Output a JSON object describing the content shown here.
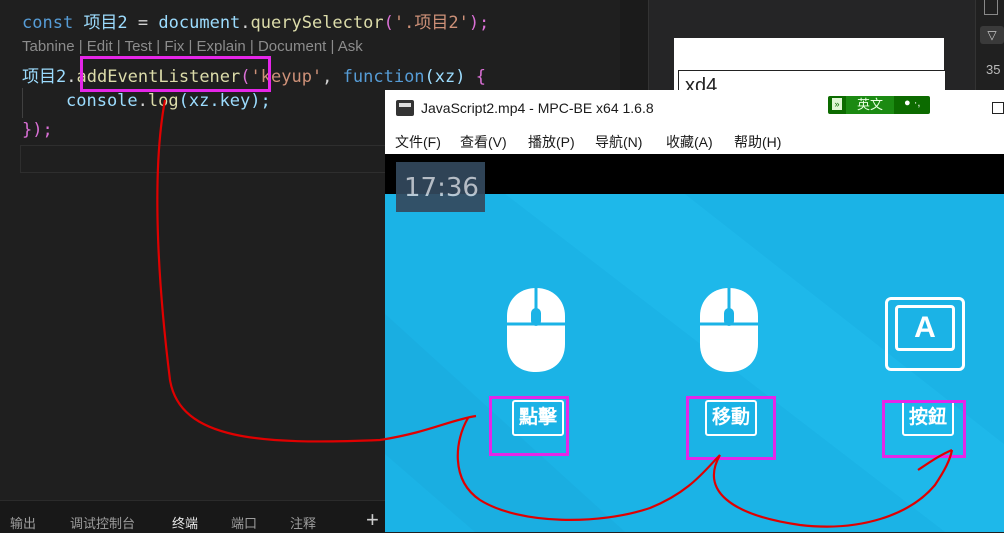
{
  "editor": {
    "line1": {
      "kw": "const",
      "var": "项目2",
      "op": " = ",
      "obj": "document",
      "dot": ".",
      "fn": "querySelector",
      "open": "(",
      "str": "'.项目2'",
      "close": ");"
    },
    "codelens": "Tabnine | Edit | Test | Fix | Explain | Document | Ask",
    "line2": {
      "var": "项目2",
      "dot": ".",
      "fn": "addEventListener",
      "open": "(",
      "str": "'keyup'",
      "comma": ", ",
      "kw": "function",
      "param": "(xz)",
      "brace": " {"
    },
    "line3": {
      "obj": "console",
      "dot": ".",
      "fn": "log",
      "arg": "(xz.key);"
    },
    "line4": "});"
  },
  "panel_tabs": [
    "输出",
    "调试控制台",
    "终端",
    "端口",
    "注释"
  ],
  "panel_active_tab": "终端",
  "panel_plus": "+",
  "right_pane": {
    "input_value": "xd4",
    "side_number": "35"
  },
  "player": {
    "title": "JavaScript2.mp4 - MPC-BE x64 1.6.8",
    "ime_label": "英文",
    "ime_dots": "● ·,",
    "menu": [
      "文件(F)",
      "查看(V)",
      "播放(P)",
      "导航(N)",
      "收藏(A)",
      "帮助(H)"
    ],
    "timestamp": "17:36",
    "tiles": [
      {
        "icon": "mouse-icon",
        "label": "點擊"
      },
      {
        "icon": "mouse-icon",
        "label": "移動"
      },
      {
        "icon": "keyboard-key-icon",
        "key": "A",
        "label": "按鈕"
      }
    ]
  },
  "colors": {
    "highlight": "#e526e8",
    "annotation": "#e00000",
    "video_bg": "#1bb3e6"
  }
}
